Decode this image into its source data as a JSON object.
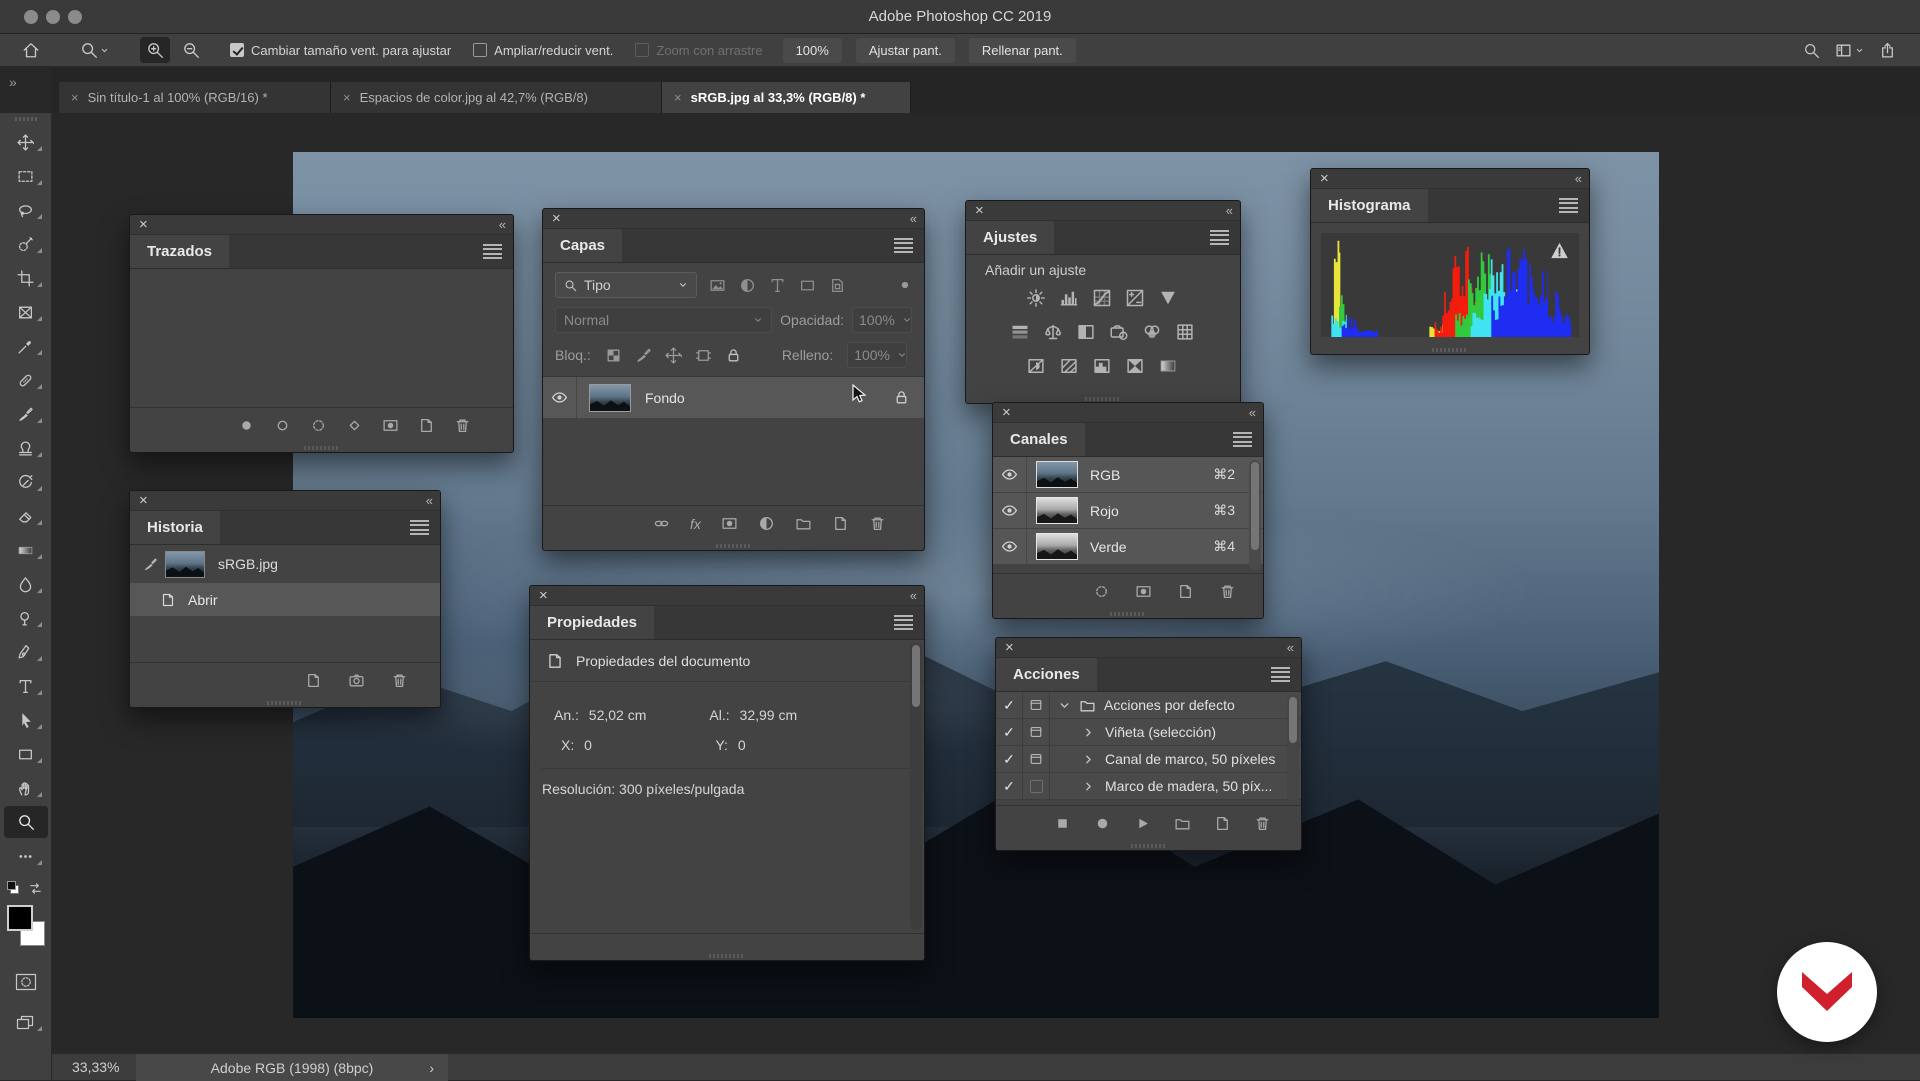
{
  "window": {
    "title": "Adobe Photoshop CC 2019"
  },
  "dock": {
    "toggle": "»"
  },
  "chrome": {
    "close": "×",
    "collapse": "«"
  },
  "icons": {
    "fx": "fx",
    "check": "✓"
  },
  "options_bar": {
    "resize_windows_label": "Cambiar tamaño vent. para ajustar",
    "zoom_all_label": "Ampliar/reducir vent.",
    "scrubby_label": "Zoom con arrastre",
    "zoom_value": "100%",
    "fit_screen": "Ajustar pant.",
    "fill_screen": "Rellenar pant."
  },
  "tabs": [
    {
      "label": "Sin título-1 al 100% (RGB/16) *",
      "active": false
    },
    {
      "label": "Espacios de color.jpg al 42,7% (RGB/8)",
      "active": false
    },
    {
      "label": "sRGB.jpg al 33,3% (RGB/8) *",
      "active": true
    }
  ],
  "panels": {
    "trazados": {
      "title": "Trazados"
    },
    "capas": {
      "title": "Capas",
      "filter_value": "Tipo",
      "blend_mode": "Normal",
      "opacity_label": "Opacidad:",
      "opacity_value": "100%",
      "lock_label": "Bloq.:",
      "fill_label": "Relleno:",
      "fill_value": "100%",
      "layer_name": "Fondo"
    },
    "historia": {
      "title": "Historia",
      "items": [
        {
          "label": "sRGB.jpg"
        },
        {
          "label": "Abrir"
        }
      ]
    },
    "propiedades": {
      "title": "Propiedades",
      "subtitle": "Propiedades del documento",
      "width_label": "An.:",
      "width_value": "52,02 cm",
      "height_label": "Al.:",
      "height_value": "32,99 cm",
      "x_label": "X:",
      "x_value": "0",
      "y_label": "Y:",
      "y_value": "0",
      "resolution": "Resolución: 300 píxeles/pulgada"
    },
    "ajustes": {
      "title": "Ajustes",
      "subtitle": "Añadir un ajuste"
    },
    "canales": {
      "title": "Canales",
      "items": [
        {
          "name": "RGB",
          "shortcut": "⌘2"
        },
        {
          "name": "Rojo",
          "shortcut": "⌘3"
        },
        {
          "name": "Verde",
          "shortcut": "⌘4"
        }
      ]
    },
    "acciones": {
      "title": "Acciones",
      "items": [
        {
          "label": "Acciones por defecto",
          "checked": true,
          "dialog": true,
          "folder": true,
          "expanded": true
        },
        {
          "label": "Viñeta (selección)",
          "checked": true,
          "dialog": true,
          "folder": false,
          "expanded": false
        },
        {
          "label": "Canal de marco, 50 píxeles",
          "checked": true,
          "dialog": true,
          "folder": false,
          "expanded": false
        },
        {
          "label": "Marco de madera, 50 píx...",
          "checked": true,
          "dialog": false,
          "folder": false,
          "expanded": false
        }
      ]
    },
    "histograma": {
      "title": "Histograma"
    }
  },
  "status_bar": {
    "zoom": "33,33%",
    "profile": "Adobe RGB (1998) (8bpc)",
    "chevron": "›"
  },
  "chart_data": {
    "type": "histogram",
    "title": "Histograma",
    "note": "RGB-channel luminosity histogram; x = tone 0-100%, h = relative count 0-100%",
    "series": [
      {
        "name": "yellow",
        "color": "#e8e438",
        "envelope": [
          [
            5,
            7.5,
            45,
            97
          ],
          [
            42,
            50,
            4,
            12
          ],
          [
            50,
            58,
            10,
            24
          ],
          [
            58,
            66,
            14,
            30
          ],
          [
            66,
            71,
            4,
            12
          ]
        ]
      },
      {
        "name": "red",
        "color": "#f21d0d",
        "envelope": [
          [
            44,
            47,
            4,
            16
          ],
          [
            47,
            51,
            16,
            45
          ],
          [
            51,
            58,
            35,
            88
          ],
          [
            58,
            62,
            18,
            55
          ],
          [
            62,
            65,
            5,
            14
          ]
        ]
      },
      {
        "name": "green",
        "color": "#31c93e",
        "envelope": [
          [
            7,
            9.5,
            15,
            55
          ],
          [
            52,
            57,
            8,
            26
          ],
          [
            57,
            66,
            30,
            82
          ],
          [
            66,
            71,
            12,
            40
          ],
          [
            71,
            74,
            4,
            10
          ]
        ]
      },
      {
        "name": "cyan",
        "color": "#3fe3f2",
        "envelope": [
          [
            4,
            10,
            8,
            22
          ],
          [
            58,
            63,
            10,
            24
          ],
          [
            63,
            72,
            32,
            75
          ],
          [
            72,
            79,
            12,
            48
          ],
          [
            79,
            82,
            4,
            12
          ]
        ]
      },
      {
        "name": "blue",
        "color": "#1f2df2",
        "envelope": [
          [
            8,
            14,
            8,
            20
          ],
          [
            14,
            22,
            3,
            8
          ],
          [
            66,
            72,
            15,
            42
          ],
          [
            72,
            80,
            42,
            92
          ],
          [
            80,
            88,
            30,
            78
          ],
          [
            88,
            93,
            14,
            50
          ],
          [
            93,
            97,
            5,
            26
          ]
        ]
      }
    ]
  }
}
